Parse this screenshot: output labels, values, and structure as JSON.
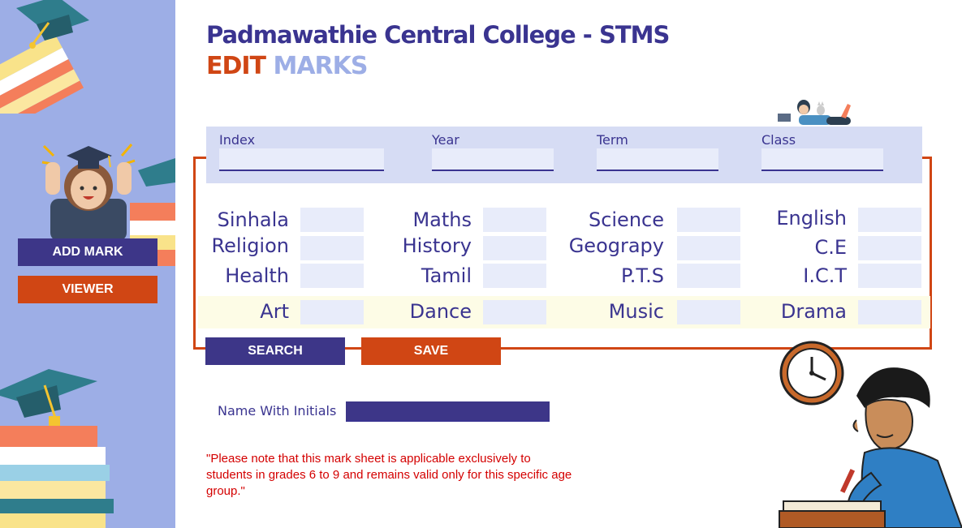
{
  "header": {
    "title": "Padmawathie Central College - STMS",
    "subtitle_part1": "EDIT",
    "subtitle_part2": "MARKS"
  },
  "sidebar": {
    "add_mark_label": "ADD MARK",
    "viewer_label": "VIEWER"
  },
  "search_fields": {
    "index_label": "Index",
    "year_label": "Year",
    "term_label": "Term",
    "class_label": "Class",
    "index_value": "",
    "year_value": "",
    "term_value": "",
    "class_value": ""
  },
  "subjects": {
    "sinhala": "Sinhala",
    "religion": "Religion",
    "health": "Health",
    "art": "Art",
    "maths": "Maths",
    "history": "History",
    "tamil": "Tamil",
    "dance": "Dance",
    "science": "Science",
    "geography": "Geograpy",
    "pts": "P.T.S",
    "music": "Music",
    "english": "English",
    "ce": "C.E",
    "ict": "I.C.T",
    "drama": "Drama"
  },
  "actions": {
    "search_label": "SEARCH",
    "save_label": "SAVE"
  },
  "student": {
    "name_label": "Name With Initials",
    "name_value": ""
  },
  "note": "\"Please note that this mark sheet is applicable exclusively to students in grades 6 to 9 and remains valid only for this specific age group.\"",
  "colors": {
    "primary": "#3d3688",
    "accent": "#d04614",
    "sidebar": "#9daee6",
    "band": "#d6dcf4",
    "input": "#e8ecfa",
    "highlight": "#fdfce6",
    "note": "#d40000"
  }
}
